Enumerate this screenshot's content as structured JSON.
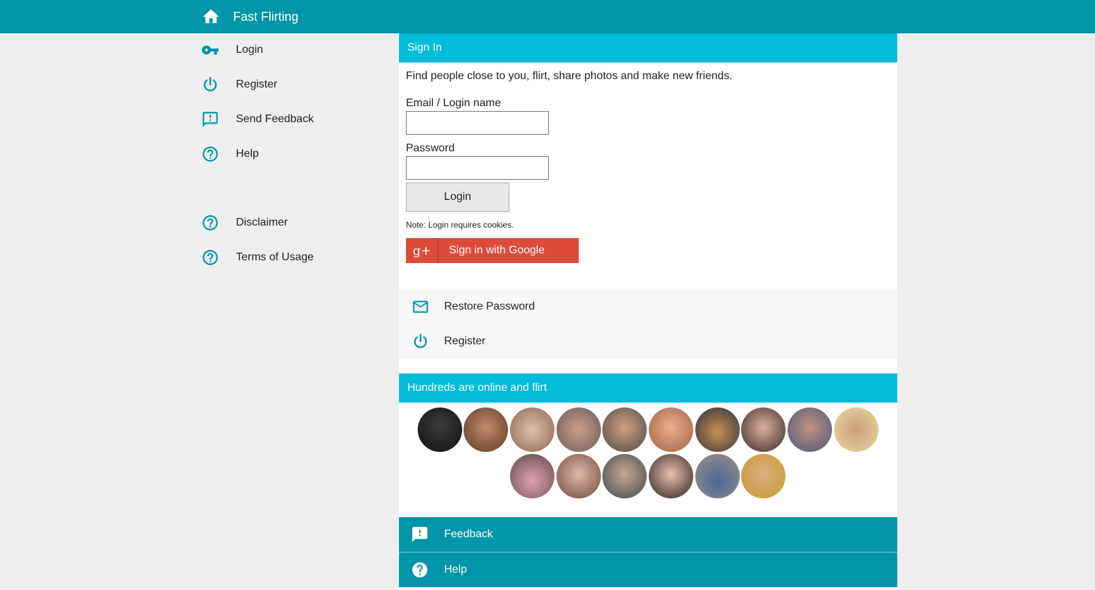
{
  "header": {
    "title": "Fast Flirting",
    "icon": "home-icon"
  },
  "sidebar": {
    "items": [
      {
        "label": "Login",
        "icon": "key-icon"
      },
      {
        "label": "Register",
        "icon": "power-icon"
      },
      {
        "label": "Send Feedback",
        "icon": "feedback-icon"
      },
      {
        "label": "Help",
        "icon": "help-icon"
      },
      {
        "label": "Disclaimer",
        "icon": "help-icon"
      },
      {
        "label": "Terms of Usage",
        "icon": "help-icon"
      }
    ]
  },
  "signin": {
    "title": "Sign In",
    "intro": "Find people close to you, flirt, share photos and make new friends.",
    "email_label": "Email / Login name",
    "email_value": "",
    "password_label": "Password",
    "password_value": "",
    "login_button": "Login",
    "note": "Note: Login requires cookies.",
    "google_icon": "g+",
    "google_button": "Sign in with Google"
  },
  "links": {
    "restore": "Restore Password",
    "register": "Register"
  },
  "online": {
    "title": "Hundreds are online and flirt"
  },
  "footer": {
    "feedback": "Feedback",
    "help": "Help"
  },
  "colors": {
    "topbar": "#0095a8",
    "section_header": "#00bcd8",
    "icon_teal": "#0097a7",
    "google_red": "#dd4b39"
  }
}
